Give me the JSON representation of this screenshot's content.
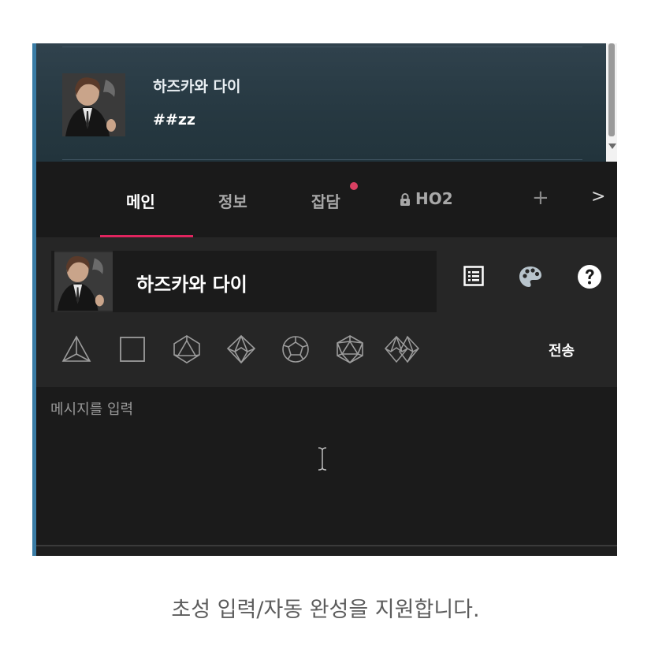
{
  "chat": {
    "message": {
      "name": "하즈카와 다이",
      "text": "##zz"
    }
  },
  "tabs": [
    {
      "label": "메인",
      "active": true
    },
    {
      "label": "정보"
    },
    {
      "label": "잡담",
      "unread": true
    },
    {
      "label": "HO2",
      "locked": true
    },
    {
      "label": "+"
    },
    {
      "label": ">"
    }
  ],
  "composer": {
    "character_name": "하즈카와 다이",
    "tools": [
      "list-icon",
      "palette-icon",
      "help-icon"
    ],
    "dice": [
      "d4",
      "d6",
      "d8",
      "d10",
      "d12",
      "d20",
      "d100"
    ],
    "send_label": "전송",
    "input_placeholder": "메시지를 입력"
  },
  "caption": "초성 입력/자동 완성을 지원합니다.",
  "colors": {
    "accent": "#e0245e",
    "tab_dot": "#d94062",
    "left_accent": "#3a7ca5"
  }
}
